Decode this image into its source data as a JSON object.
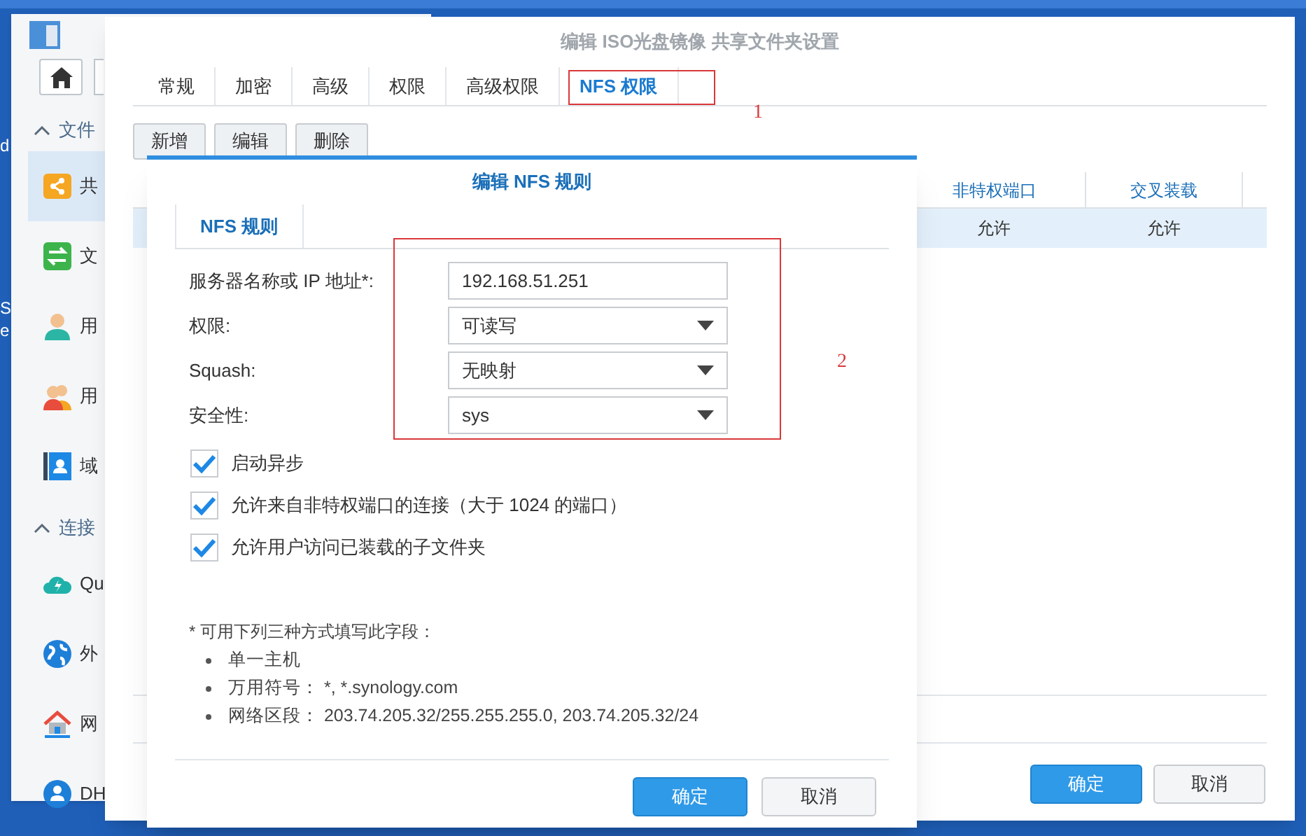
{
  "desktop_fragments": [
    "d",
    "S",
    "e"
  ],
  "back_window": {
    "sidebar": [
      {
        "kind": "header",
        "label": "文件"
      },
      {
        "kind": "item",
        "label": "共",
        "selected": true
      },
      {
        "kind": "item",
        "label": "文",
        "selected": false
      },
      {
        "kind": "item",
        "label": "用",
        "selected": false
      },
      {
        "kind": "item",
        "label": "用",
        "selected": false
      },
      {
        "kind": "item",
        "label": "域",
        "selected": false
      },
      {
        "kind": "header",
        "label": "连接"
      },
      {
        "kind": "item",
        "label": "Qu",
        "selected": false
      },
      {
        "kind": "item",
        "label": "外",
        "selected": false
      },
      {
        "kind": "item",
        "label": "网",
        "selected": false
      },
      {
        "kind": "item",
        "label": "DH",
        "selected": false
      }
    ]
  },
  "settings_window": {
    "title": "编辑 ISO光盘镜像 共享文件夹设置",
    "tabs": [
      {
        "label": "常规",
        "selected": false
      },
      {
        "label": "加密",
        "selected": false
      },
      {
        "label": "高级",
        "selected": false
      },
      {
        "label": "权限",
        "selected": false
      },
      {
        "label": "高级权限",
        "selected": false
      },
      {
        "label": "NFS 权限",
        "selected": true
      }
    ],
    "toolbar": [
      "新增",
      "编辑",
      "删除"
    ],
    "table": {
      "columns": [
        "非特权端口",
        "交叉装载"
      ],
      "rows": [
        {
          "cells": [
            "允许",
            "允许"
          ],
          "selected": true
        }
      ]
    },
    "buttons": [
      {
        "label": "确定",
        "kind": "primary"
      },
      {
        "label": "取消",
        "kind": "secondary"
      }
    ]
  },
  "dialog": {
    "title": "编辑 NFS 规则",
    "tabs": [
      {
        "label": "NFS 规则",
        "selected": true
      }
    ],
    "fields": [
      {
        "label": "服务器名称或 IP 地址*:",
        "kind": "text",
        "value": "192.168.51.251"
      },
      {
        "label": "权限:",
        "kind": "select",
        "value": "可读写"
      },
      {
        "label": "Squash:",
        "kind": "select",
        "value": "无映射"
      },
      {
        "label": "安全性:",
        "kind": "select",
        "value": "sys"
      }
    ],
    "checkboxes": [
      {
        "label": "启动异步",
        "checked": true
      },
      {
        "label": "允许来自非特权端口的连接（大于 1024 的端口）",
        "checked": true
      },
      {
        "label": "允许用户访问已装载的子文件夹",
        "checked": true
      }
    ],
    "note": "* 可用下列三种方式填写此字段：",
    "bullets": [
      "单一主机",
      "万用符号： *, *.synology.com",
      "网络区段： 203.74.205.32/255.255.255.0, 203.74.205.32/24"
    ],
    "buttons": [
      {
        "label": "确定",
        "kind": "primary"
      },
      {
        "label": "取消",
        "kind": "secondary"
      }
    ]
  },
  "annotations": [
    {
      "label": "1"
    },
    {
      "label": "2"
    }
  ]
}
